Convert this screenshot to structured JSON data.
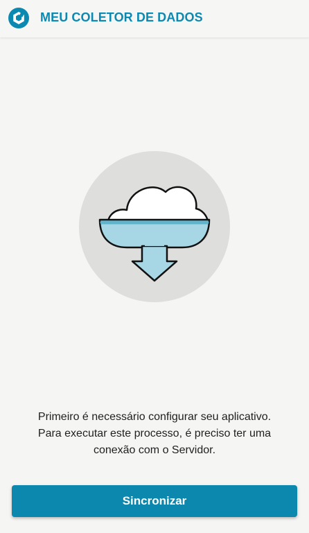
{
  "app_bar": {
    "logo_icon": "app-logo-icon",
    "title": "MEU COLETOR DE DADOS"
  },
  "illustration": {
    "icon": "cloud-download-icon"
  },
  "message": {
    "line1": "Primeiro é necessário configurar seu aplicativo.",
    "line2": "Para executar este processo, é preciso ter uma",
    "line3": "conexão com o Servidor."
  },
  "sync_button": {
    "label": "Sincronizar"
  },
  "colors": {
    "brand": "#0b89b0",
    "button": "#0c88ae",
    "background": "#f5f5f4",
    "circle": "#dededd",
    "water": "#a7d6e4"
  }
}
